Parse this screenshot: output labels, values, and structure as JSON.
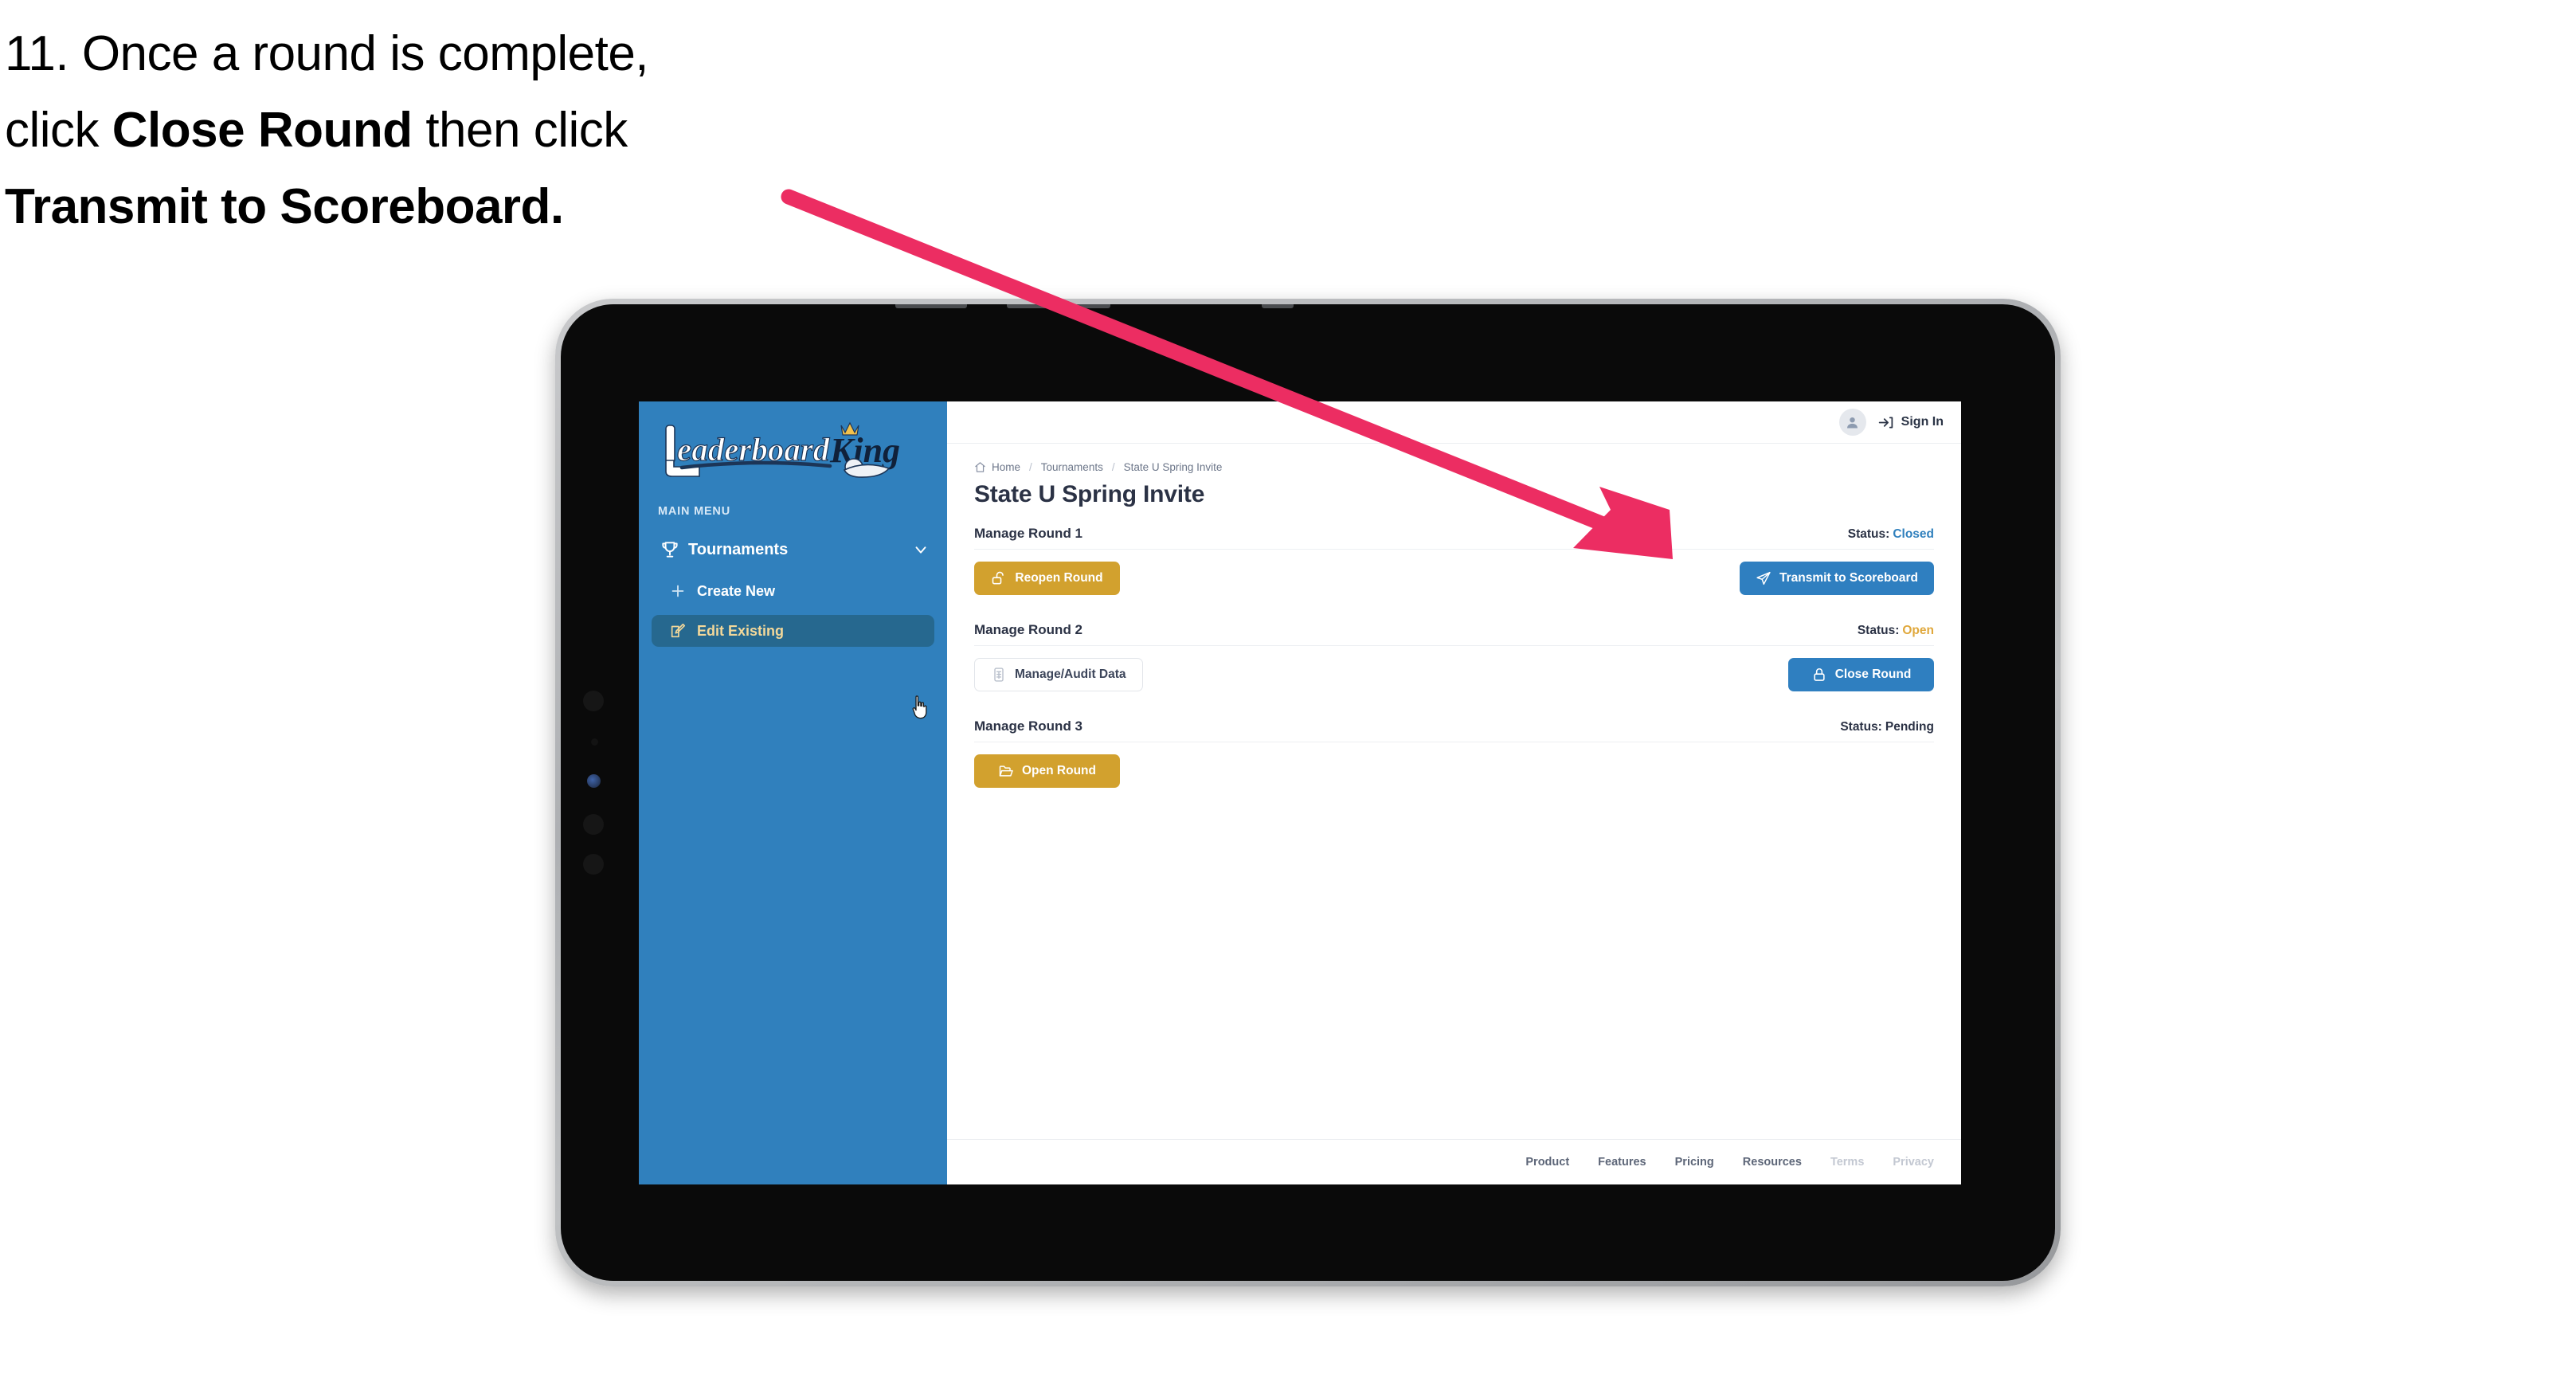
{
  "caption": {
    "line1_pre": "11. Once a round is complete,",
    "line2_pre": "click ",
    "line2_bold": "Close Round",
    "line2_post": " then click",
    "line3_bold": "Transmit to Scoreboard."
  },
  "annotation": {
    "arrow_color": "#ec2d62",
    "arrow_start": "990,247",
    "arrow_end": "2100,702"
  },
  "app": {
    "logo_text_left": "Leaderboard",
    "logo_text_right": "King",
    "sidebar": {
      "menu_label": "MAIN MENU",
      "nav": {
        "label": "Tournaments",
        "icon": "trophy-icon",
        "chevron": "chevron-down-icon"
      },
      "items": [
        {
          "label": "Create New",
          "icon": "plus-icon",
          "active": false
        },
        {
          "label": "Edit Existing",
          "icon": "edit-square-icon",
          "active": true
        }
      ],
      "bg_color": "#3080bd",
      "active_bg_color": "#26688f",
      "active_text_color": "#f3d89a"
    },
    "topbar": {
      "avatar": "user-avatar-icon",
      "signin_icon": "sign-in-arrow-icon",
      "signin_label": "Sign In"
    },
    "breadcrumb": {
      "home_icon": "home-icon",
      "items": [
        "Home",
        "Tournaments",
        "State U Spring Invite"
      ],
      "separator": "/"
    },
    "page_title": "State U Spring Invite",
    "rounds": [
      {
        "title": "Manage Round 1",
        "status_label": "Status:",
        "status_value": "Closed",
        "status_color": "#3080bd",
        "left_button": {
          "label": "Reopen Round",
          "icon": "unlock-icon",
          "style": "gold"
        },
        "right_button": {
          "label": "Transmit to Scoreboard",
          "icon": "paper-plane-icon",
          "style": "blue"
        }
      },
      {
        "title": "Manage Round 2",
        "status_label": "Status:",
        "status_value": "Open",
        "status_color": "#e0a83c",
        "left_button": {
          "label": "Manage/Audit Data",
          "icon": "spreadsheet-icon",
          "style": "ghost"
        },
        "right_button": {
          "label": "Close Round",
          "icon": "lock-icon",
          "style": "blue"
        }
      },
      {
        "title": "Manage Round 3",
        "status_label": "Status:",
        "status_value": "Pending",
        "status_color": "#2b3245",
        "left_button": {
          "label": "Open Round",
          "icon": "open-folder-icon",
          "style": "gold"
        },
        "right_button": null
      }
    ],
    "footer": {
      "links": [
        {
          "label": "Product",
          "muted": false
        },
        {
          "label": "Features",
          "muted": false
        },
        {
          "label": "Pricing",
          "muted": false
        },
        {
          "label": "Resources",
          "muted": false
        },
        {
          "label": "Terms",
          "muted": true
        },
        {
          "label": "Privacy",
          "muted": true
        }
      ]
    }
  }
}
